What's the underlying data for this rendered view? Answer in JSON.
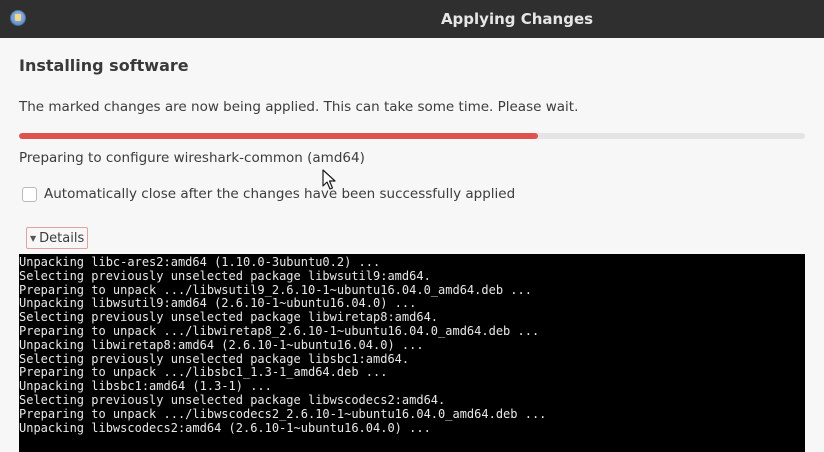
{
  "window": {
    "title": "Applying Changes",
    "icon": "software-updater-icon"
  },
  "main": {
    "heading": "Installing software",
    "message": "The marked changes are now being applied. This can take some time. Please wait.",
    "progress": 0.66,
    "status": "Preparing to configure wireshark-common (amd64)",
    "auto_close": {
      "label": "Automatically close after the changes have been successfully applied",
      "checked": false
    },
    "details": {
      "label": "Details",
      "expanded": true
    }
  },
  "terminal": {
    "lines": [
      "Unpacking libc-ares2:amd64 (1.10.0-3ubuntu0.2) ...",
      "Selecting previously unselected package libwsutil9:amd64.",
      "Preparing to unpack .../libwsutil9_2.6.10-1~ubuntu16.04.0_amd64.deb ...",
      "Unpacking libwsutil9:amd64 (2.6.10-1~ubuntu16.04.0) ...",
      "Selecting previously unselected package libwiretap8:amd64.",
      "Preparing to unpack .../libwiretap8_2.6.10-1~ubuntu16.04.0_amd64.deb ...",
      "Unpacking libwiretap8:amd64 (2.6.10-1~ubuntu16.04.0) ...",
      "Selecting previously unselected package libsbc1:amd64.",
      "Preparing to unpack .../libsbc1_1.3-1_amd64.deb ...",
      "Unpacking libsbc1:amd64 (1.3-1) ...",
      "Selecting previously unselected package libwscodecs2:amd64.",
      "Preparing to unpack .../libwscodecs2_2.6.10-1~ubuntu16.04.0_amd64.deb ...",
      "Unpacking libwscodecs2:amd64 (2.6.10-1~ubuntu16.04.0) ..."
    ]
  },
  "colors": {
    "titlebar": "#2f2f2f",
    "progress_fill": "#e0524f",
    "progress_track": "#e4e4e4",
    "terminal_bg": "#000000",
    "terminal_fg": "#e8e8e8"
  }
}
